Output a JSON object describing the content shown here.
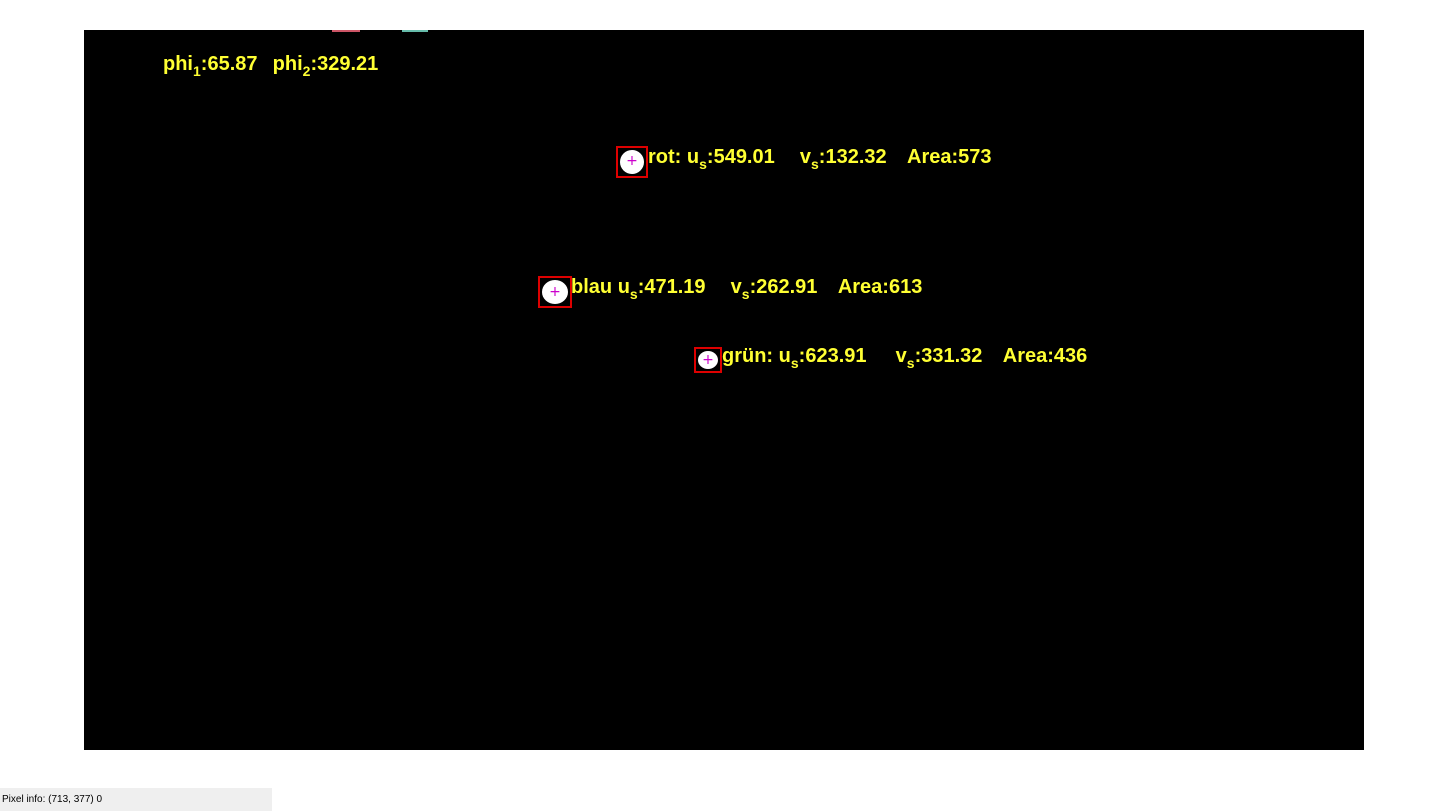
{
  "overlay": {
    "phi": {
      "phi1_base": "phi",
      "phi1_sub": "1",
      "phi1_value": ":65.87",
      "phi2_base": "phi",
      "phi2_sub": "2",
      "phi2_value": ":329.21"
    },
    "blobs": [
      {
        "name": "rot:",
        "u_base": "u",
        "u_sub": "s",
        "u_value": ":549.01",
        "v_base": "v",
        "v_sub": "s",
        "v_value": ":132.32",
        "area": "Area:573"
      },
      {
        "name": "blau",
        "u_base": "u",
        "u_sub": "s",
        "u_value": ":471.19",
        "v_base": "v",
        "v_sub": "s",
        "v_value": ":262.91",
        "area": "Area:613"
      },
      {
        "name": "grün:",
        "u_base": "u",
        "u_sub": "s",
        "u_value": ":623.91",
        "v_base": "v",
        "v_sub": "s",
        "v_value": ":331.32",
        "area": "Area:436"
      }
    ],
    "centroid_marker": "+"
  },
  "status_bar": {
    "text": "Pixel info: (713, 377)  0"
  },
  "colors": {
    "canvas": "#000000",
    "label_text": "#ffff33",
    "bbox": "#dd0000",
    "centroid": "#cc00cc",
    "blob": "#ffffff"
  }
}
